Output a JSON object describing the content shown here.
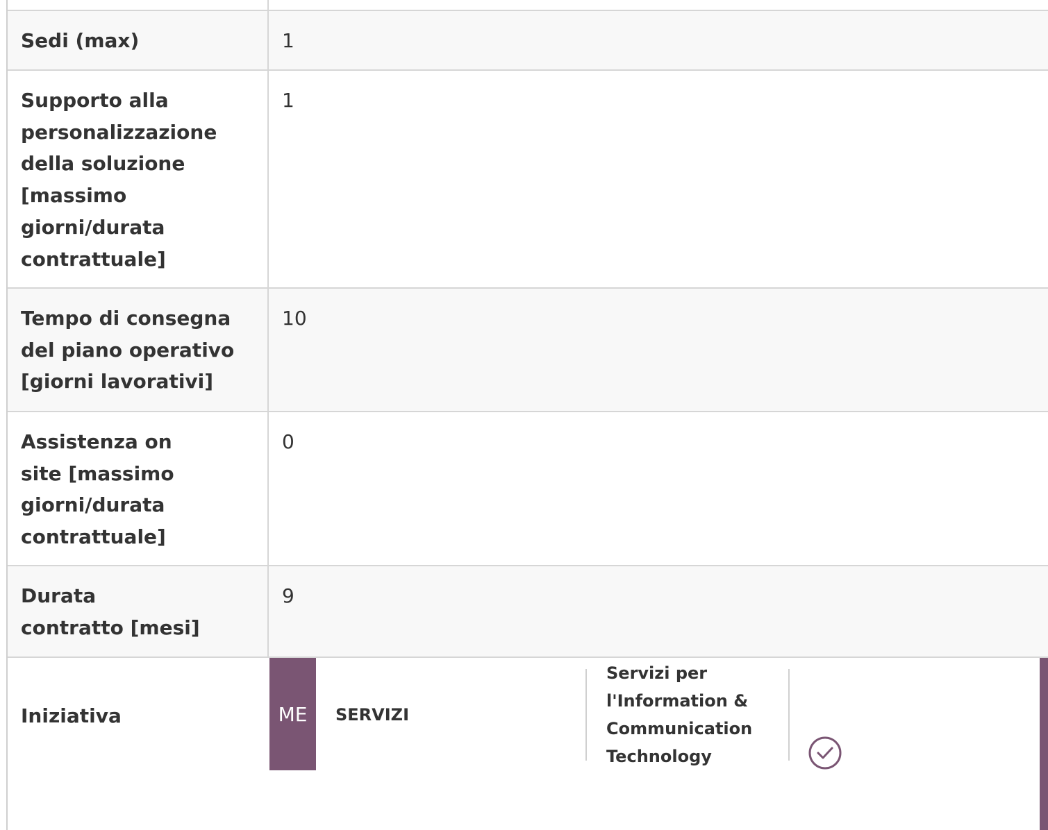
{
  "rows": [
    {
      "label": "Sedi (max)",
      "value": "1"
    },
    {
      "label": "Supporto alla personalizzazione della soluzione [massimo giorni/durata contrattuale]",
      "value": "1"
    },
    {
      "label": "Tempo di consegna del piano operativo [giorni lavorativi]",
      "value": "10"
    },
    {
      "label": "Assistenza on site [massimo giorni/durata contrattuale]",
      "value": "0"
    },
    {
      "label": "Durata contratto [mesi]",
      "value": "9"
    }
  ],
  "iniziativa": {
    "label": "Iniziativa",
    "badge": "ME",
    "type": "SERVIZI",
    "category": "Servizi per l'Information & Communication Technology",
    "status_icon": "check-circle-icon"
  },
  "colors": {
    "accent": "#7a5573",
    "row_shaded": "#f8f8f8",
    "border": "#d6d6d6"
  }
}
